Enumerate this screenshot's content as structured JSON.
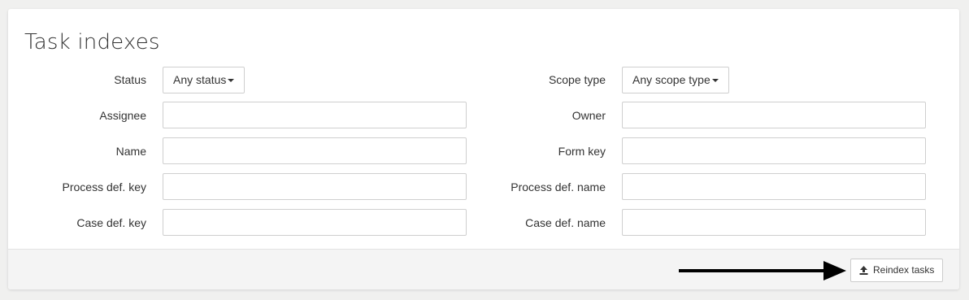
{
  "page": {
    "title": "Task indexes"
  },
  "filters": {
    "status": {
      "label": "Status",
      "selected": "Any status"
    },
    "scope_type": {
      "label": "Scope type",
      "selected": "Any scope type"
    },
    "assignee": {
      "label": "Assignee",
      "value": ""
    },
    "owner": {
      "label": "Owner",
      "value": ""
    },
    "name": {
      "label": "Name",
      "value": ""
    },
    "form_key": {
      "label": "Form key",
      "value": ""
    },
    "process_def_key": {
      "label": "Process def. key",
      "value": ""
    },
    "process_def_name": {
      "label": "Process def. name",
      "value": ""
    },
    "case_def_key": {
      "label": "Case def. key",
      "value": ""
    },
    "case_def_name": {
      "label": "Case def. name",
      "value": ""
    }
  },
  "footer": {
    "reindex_button": {
      "label": "Reindex tasks",
      "icon": "upload-icon"
    },
    "annotation": {
      "icon": "arrow-right-icon"
    }
  }
}
